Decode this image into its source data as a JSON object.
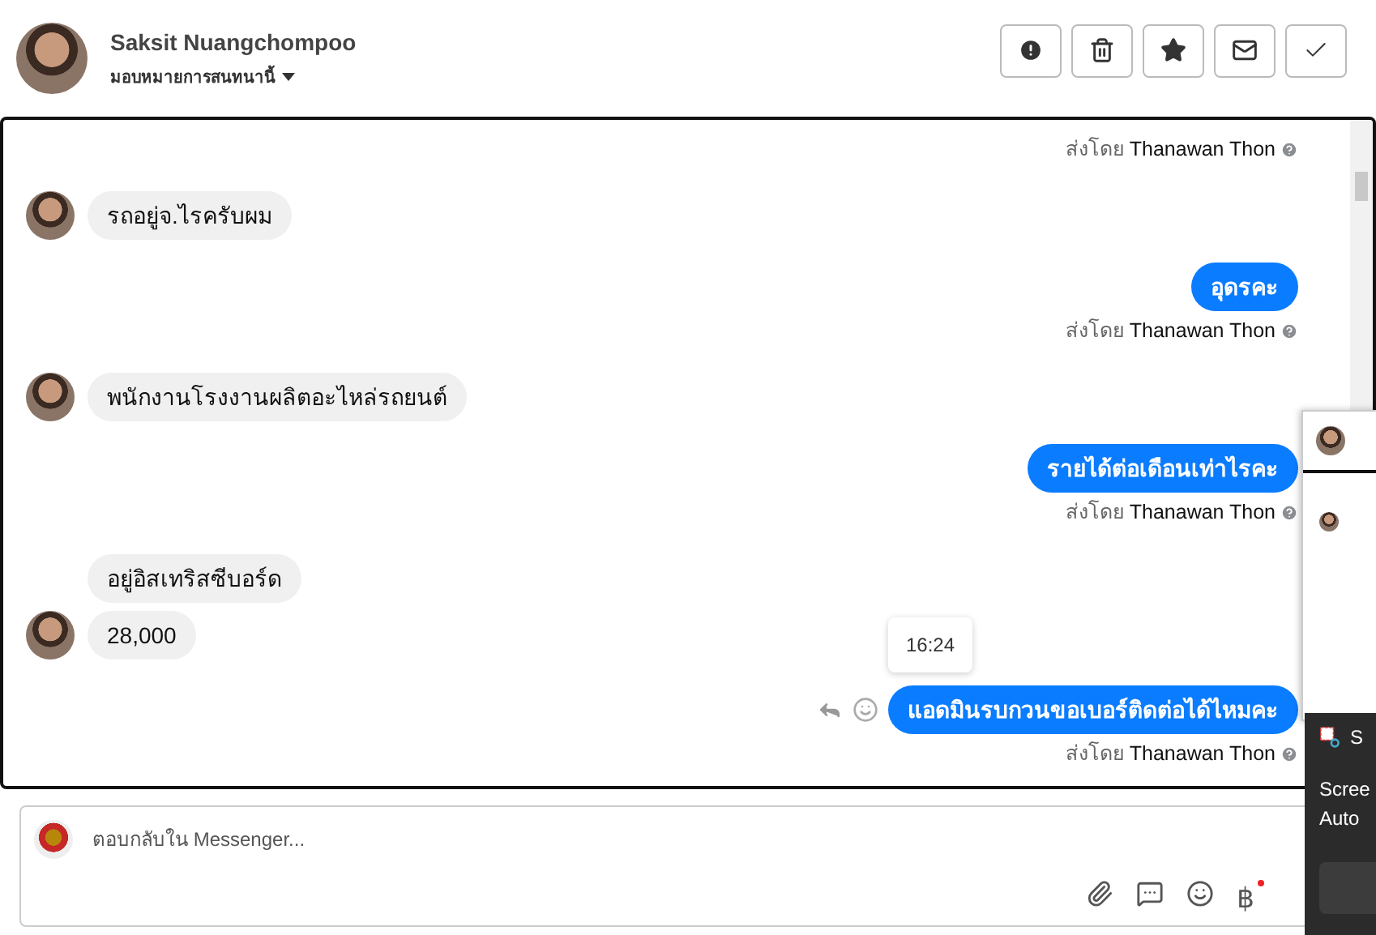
{
  "header": {
    "name": "Saksit Nuangchompoo",
    "assign_label": "มอบหมายการสนทนานี้",
    "actions": [
      {
        "kind": "spam"
      },
      {
        "kind": "delete"
      },
      {
        "kind": "star"
      },
      {
        "kind": "unread"
      },
      {
        "kind": "done"
      }
    ]
  },
  "conversation": [
    {
      "kind": "sent-by",
      "prefix": "ส่งโดย",
      "name": "Thanawan Thon"
    },
    {
      "kind": "received",
      "bubbles": [
        "รถอยู่จ.ไรครับผม"
      ]
    },
    {
      "kind": "sent",
      "text": "อุดรคะ"
    },
    {
      "kind": "sent-by",
      "prefix": "ส่งโดย",
      "name": "Thanawan Thon"
    },
    {
      "kind": "received",
      "bubbles": [
        "พนักงานโรงงานผลิตอะไหล่รถยนต์"
      ]
    },
    {
      "kind": "sent",
      "text": "รายได้ต่อเดือนเท่าไรคะ"
    },
    {
      "kind": "sent-by",
      "prefix": "ส่งโดย",
      "name": "Thanawan Thon"
    },
    {
      "kind": "received",
      "bubbles": [
        "อยู่อิสเทริสซีบอร์ด",
        "28,000"
      ]
    },
    {
      "kind": "sent",
      "text": "แอดมินรบกวนขอเบอร์ติดต่อได้ไหมคะ",
      "tooltip": "16:24",
      "hovered": true
    },
    {
      "kind": "sent-by",
      "prefix": "ส่งโดย",
      "name": "Thanawan Thon"
    }
  ],
  "composer": {
    "placeholder": "ตอบกลับใน Messenger...",
    "currency_symbol": "฿"
  },
  "notification": {
    "app_title": "S",
    "lines": [
      "Scree",
      "Auto"
    ]
  }
}
